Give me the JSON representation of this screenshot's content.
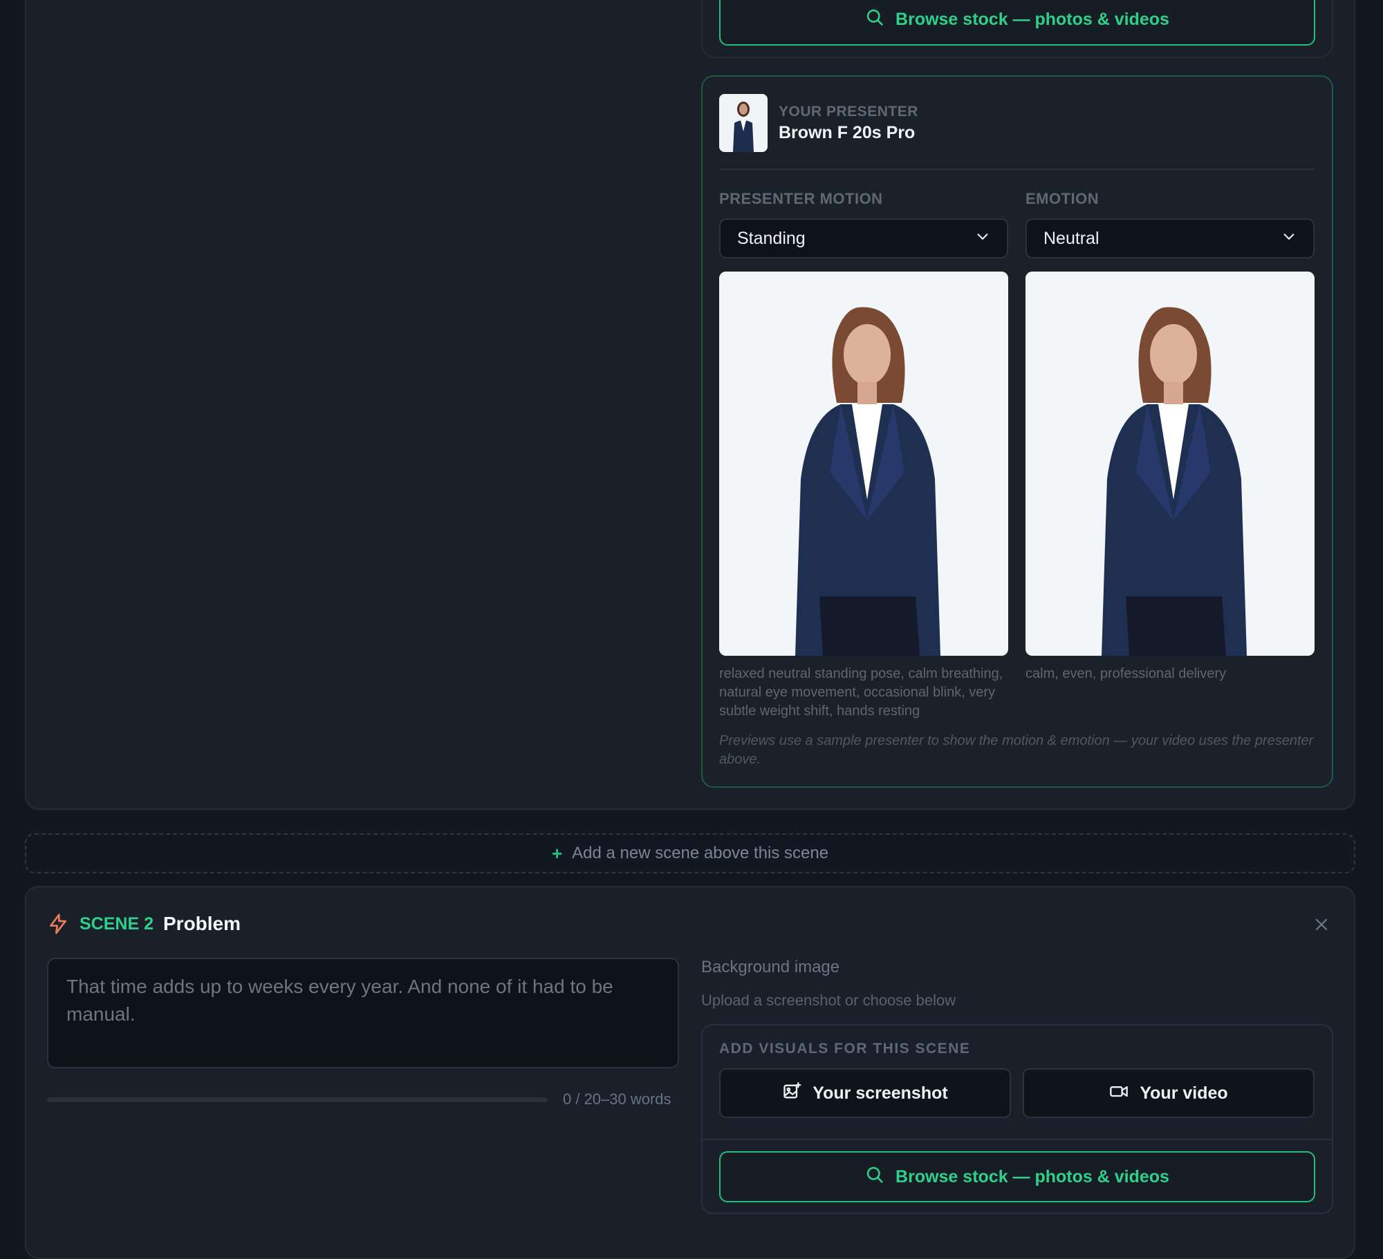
{
  "colors": {
    "accent": "#22c07a",
    "background": "#121821",
    "card": "#1a2029"
  },
  "scene1": {
    "browse_label": "Browse stock — photos & videos",
    "presenter": {
      "section_label": "YOUR PRESENTER",
      "name": "Brown F 20s Pro"
    },
    "motion": {
      "label": "PRESENTER MOTION",
      "value": "Standing",
      "description": "relaxed neutral standing pose, calm breathing, natural eye movement, occasional blink, very subtle weight shift, hands resting"
    },
    "emotion": {
      "label": "EMOTION",
      "value": "Neutral",
      "description": "calm, even, professional delivery"
    },
    "note": "Previews use a sample presenter to show the motion & emotion — your video uses the presenter above."
  },
  "add_scene_label": "Add a new scene above this scene",
  "scene2": {
    "label": "SCENE 2",
    "title": "Problem",
    "script_text": "That time adds up to weeks every year. And none of it had to be manual.",
    "word_count": "0 / 20–30 words",
    "word_progress": 0,
    "background": {
      "title": "Background image",
      "subtitle": "Upload a screenshot or choose below"
    },
    "visuals": {
      "label": "ADD VISUALS FOR THIS SCENE",
      "screenshot_label": "Your screenshot",
      "video_label": "Your video",
      "browse_label": "Browse stock — photos & videos"
    }
  }
}
